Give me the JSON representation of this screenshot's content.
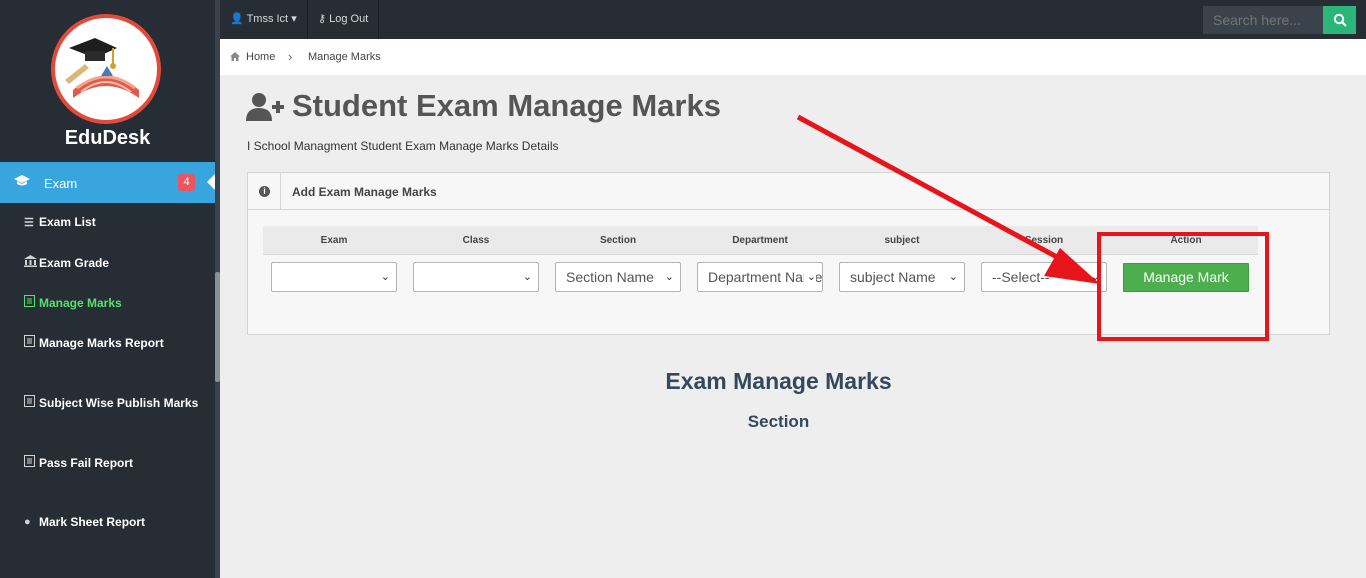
{
  "brand": {
    "name": "EduDesk"
  },
  "colors": {
    "sidebar": "#262d35",
    "active": "#39a5df",
    "accent_green": "#57e06a",
    "badge": "#e8575f",
    "button": "#4cae4c",
    "annotation": "#e8141b"
  },
  "sidebar": {
    "active_item": {
      "label": "Exam",
      "badge": "4",
      "icon": "graduation-cap-icon"
    },
    "items": [
      {
        "label": "Exam List",
        "icon": "list-icon"
      },
      {
        "label": "Exam Grade",
        "icon": "institution-icon"
      },
      {
        "label": "Manage Marks",
        "icon": "document-icon"
      },
      {
        "label": "Manage Marks Report",
        "icon": "document-icon"
      },
      {
        "label": "Subject Wise Publish Marks",
        "icon": "document-icon"
      },
      {
        "label": "Pass Fail Report",
        "icon": "document-icon"
      },
      {
        "label": "Mark Sheet Report",
        "icon": "circle-icon"
      }
    ]
  },
  "topbar": {
    "user": "Tmss Ict",
    "logout": "Log Out",
    "search_placeholder": "Search here..."
  },
  "breadcrumb": {
    "home": "Home",
    "current": "Manage Marks"
  },
  "page": {
    "title": "Student Exam Manage Marks",
    "subtitle": "I School Managment Student Exam Manage Marks Details"
  },
  "panel": {
    "title": "Add Exam Manage Marks",
    "columns": [
      "Exam",
      "Class",
      "Section",
      "Department",
      "subject",
      "Session",
      "Action"
    ],
    "selects": {
      "exam": "",
      "class": "",
      "section": "Section Name",
      "department": "Department Name",
      "subject": "subject Name",
      "session": "--Select--"
    },
    "action_button": "Manage Mark"
  },
  "results": {
    "title": "Exam Manage Marks",
    "subtitle": "Section"
  }
}
